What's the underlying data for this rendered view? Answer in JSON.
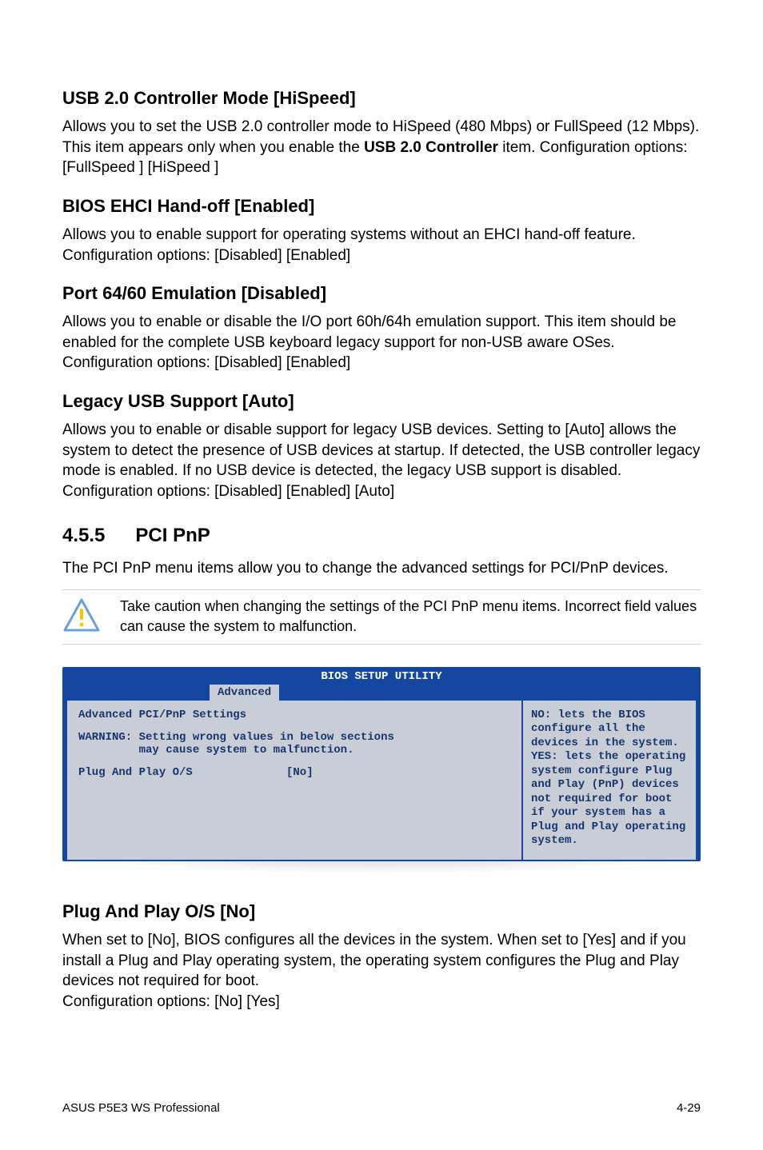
{
  "sections": {
    "usb_mode": {
      "heading": "USB 2.0 Controller Mode [HiSpeed]",
      "body_pre": "Allows you to set the USB 2.0 controller mode to HiSpeed (480 Mbps) or FullSpeed (12 Mbps). This item appears only when you enable the ",
      "body_bold": "USB 2.0 Controller",
      "body_post": " item. Configuration options: [FullSpeed ] [HiSpeed ]"
    },
    "ehci": {
      "heading": "BIOS EHCI Hand-off [Enabled]",
      "body": "Allows you to enable support for operating systems without an EHCI hand-off feature. Configuration options: [Disabled] [Enabled]"
    },
    "port6460": {
      "heading": "Port 64/60 Emulation [Disabled]",
      "body": "Allows you to enable or disable the I/O port 60h/64h emulation support. This item should be enabled for the complete USB keyboard legacy support for non-USB aware OSes. Configuration options: [Disabled] [Enabled]"
    },
    "legacy": {
      "heading": "Legacy USB Support [Auto]",
      "body": "Allows you to enable or disable support for legacy USB devices. Setting to [Auto] allows the system to detect the presence of USB devices at startup. If detected, the USB controller legacy mode is enabled. If no USB device is detected, the legacy USB support is disabled. Configuration options: [Disabled] [Enabled] [Auto]"
    },
    "pcipnp": {
      "num": "4.5.5",
      "title": "PCI PnP",
      "intro": "The PCI PnP menu items allow you to change the advanced settings for PCI/PnP devices.",
      "alert": "Take caution when changing the settings of the PCI PnP menu items. Incorrect field values can cause the system to malfunction."
    },
    "plug": {
      "heading": "Plug And Play O/S [No]",
      "body": "When set to [No], BIOS configures all the devices in the system. When set to [Yes] and if you install a Plug and Play operating system, the operating system configures the Plug and Play devices not required for boot.\nConfiguration options: [No] [Yes]"
    }
  },
  "bios": {
    "title": "BIOS SETUP UTILITY",
    "tab": "Advanced",
    "main_header": "Advanced PCI/PnP Settings",
    "warning_label": "WARNING:",
    "warning_line1": "Setting wrong values in below sections",
    "warning_line2": "may cause system to malfunction.",
    "row1_label": "Plug And Play O/S",
    "row1_value": "[No]",
    "help": "NO: lets the BIOS configure all the devices in the system.\nYES: lets the operating system configure Plug and Play (PnP) devices not required for boot if your system has a Plug and Play operating system."
  },
  "footer": {
    "left": "ASUS P5E3 WS Professional",
    "right": "4-29"
  }
}
